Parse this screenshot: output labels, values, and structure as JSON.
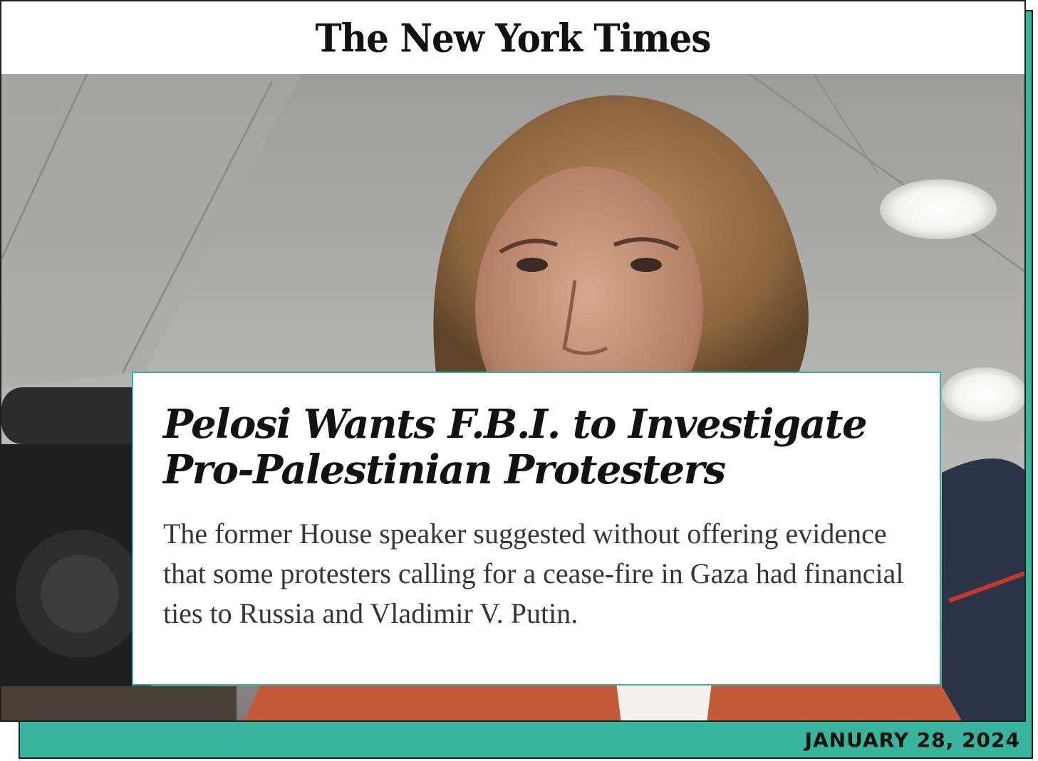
{
  "masthead": {
    "title": "The New York Times"
  },
  "article": {
    "headline": "Pelosi Wants F.B.I. to Investigate Pro-Palestinian Protesters",
    "summary": "The former House speaker suggested without offering evidence that some protesters calling for a cease-fire in Gaza had financial ties to Russia and Vladimir V. Putin."
  },
  "footer": {
    "date": "JANUARY 28, 2024"
  },
  "colors": {
    "accent": "#37b49b",
    "border": "#1f1f1f",
    "text": "#121212"
  }
}
